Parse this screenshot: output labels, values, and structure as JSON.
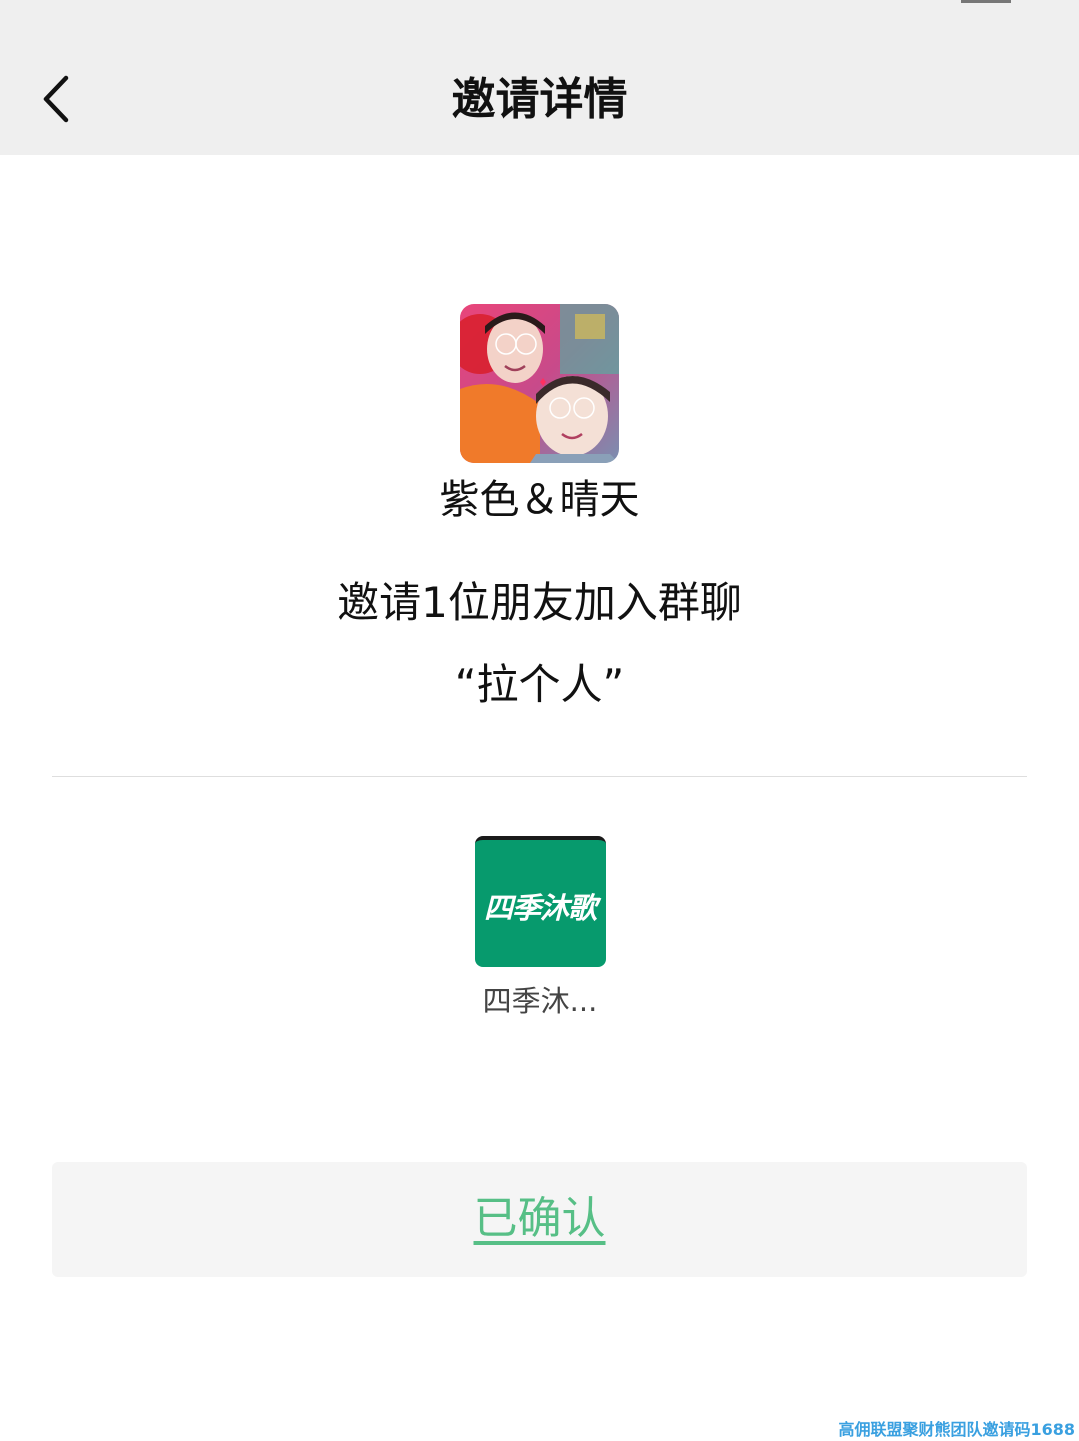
{
  "header": {
    "title": "邀请详情",
    "back_icon": "chevron-left-icon"
  },
  "invite": {
    "inviter_name": "紫色＆晴天",
    "message": "邀请1位朋友加入群聊",
    "group_name": "“拉个人”"
  },
  "members": [
    {
      "avatar_text": "四季沐歌",
      "avatar_color": "#079a6d",
      "name": "四季沐..."
    }
  ],
  "confirm_button": {
    "label": "已确认",
    "color": "#57bf86"
  },
  "watermark": {
    "text": "高佣联盟聚财熊团队邀请码1688"
  }
}
